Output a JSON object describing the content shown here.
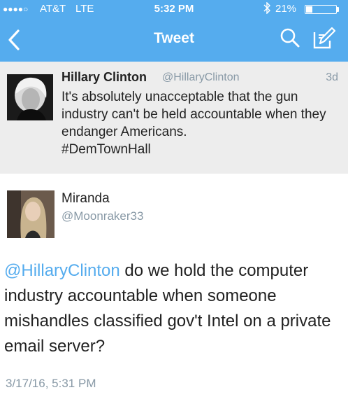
{
  "status_bar": {
    "signal": "●●●●○",
    "carrier": "AT&T",
    "network": "LTE",
    "time": "5:32 PM",
    "battery_pct": "21%",
    "battery_level": 0.21
  },
  "nav": {
    "title": "Tweet",
    "back_icon": "chevron-left-icon",
    "search_icon": "search-icon",
    "compose_icon": "compose-icon"
  },
  "tweet": {
    "author_name": "Hillary Clinton",
    "author_handle": "@HillaryClinton",
    "age": "3d",
    "text": "It's absolutely unacceptable that the gun industry can't be held accountable when they endanger Americans.",
    "hashtag": "#DemTownHall"
  },
  "reply": {
    "author_name": "Miranda",
    "author_handle": "@Moonraker33",
    "mention": "@HillaryClinton",
    "text": " do we hold the computer industry accountable when someone mishandles classified gov't Intel on a private email server?",
    "timestamp": "3/17/16, 5:31 PM"
  },
  "colors": {
    "brand": "#55acee",
    "muted": "#8899a6",
    "tweet_bg": "#ededed"
  }
}
